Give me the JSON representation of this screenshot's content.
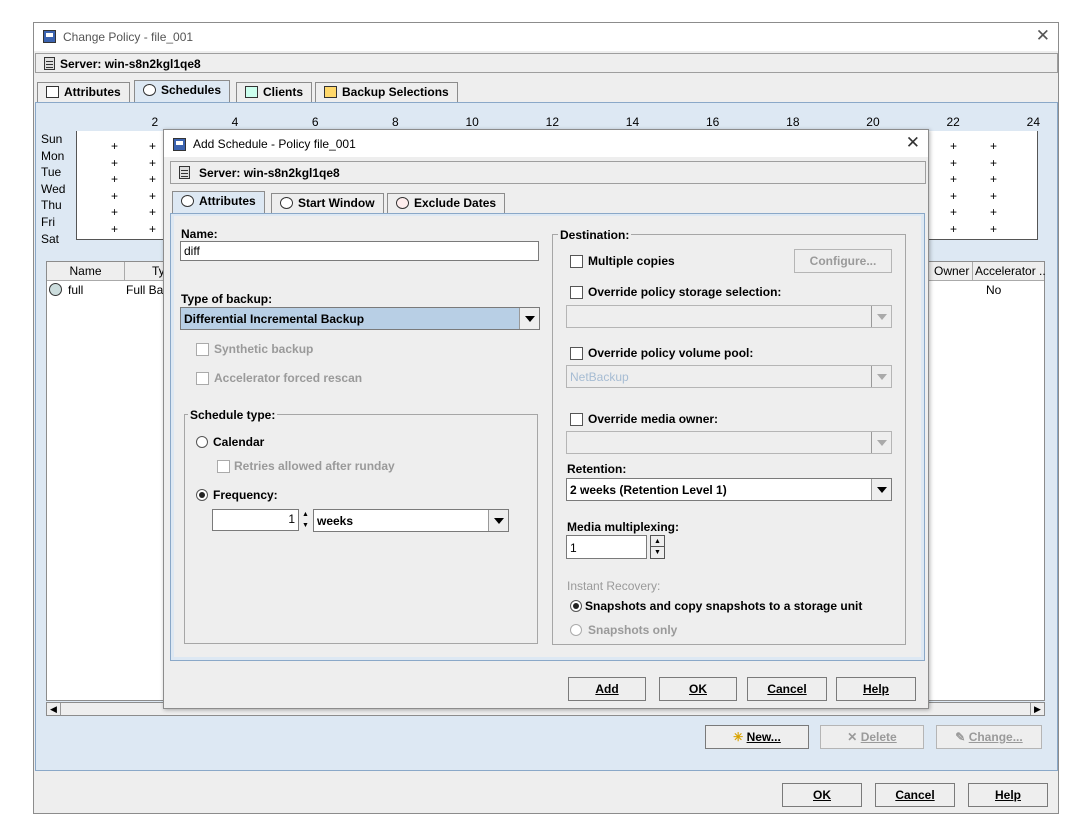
{
  "outer": {
    "title": "Change Policy - file_001",
    "server_label": "Server: win-s8n2kgl1qe8",
    "tabs": [
      "Attributes",
      "Schedules",
      "Clients",
      "Backup Selections"
    ],
    "hours": [
      "2",
      "4",
      "6",
      "8",
      "10",
      "12",
      "14",
      "16",
      "18",
      "20",
      "22",
      "24"
    ],
    "days": [
      "Sun",
      "Mon",
      "Tue",
      "Wed",
      "Thu",
      "Fri",
      "Sat"
    ],
    "columns": [
      "Name",
      "Ty",
      "Owner",
      "Accelerator ..."
    ],
    "row": {
      "name": "full",
      "type": "Full Ba",
      "accelerator": "No"
    },
    "buttons": {
      "new": "New...",
      "delete": "Delete",
      "change": "Change..."
    },
    "footer": {
      "ok": "OK",
      "cancel": "Cancel",
      "help": "Help"
    }
  },
  "dialog": {
    "title": "Add Schedule - Policy file_001",
    "server_label": "Server: win-s8n2kgl1qe8",
    "tabs": [
      "Attributes",
      "Start Window",
      "Exclude Dates"
    ],
    "name_label": "Name:",
    "name_value": "diff",
    "type_label": "Type of backup:",
    "type_value": "Differential Incremental Backup",
    "synthetic": "Synthetic backup",
    "accelerator_rescan": "Accelerator forced rescan",
    "schedule_type_label": "Schedule type:",
    "calendar": "Calendar",
    "retries": "Retries allowed after runday",
    "frequency": "Frequency:",
    "frequency_value": "1",
    "frequency_unit": "weeks",
    "destination_label": "Destination:",
    "multiple_copies": "Multiple copies",
    "configure": "Configure...",
    "override_storage": "Override policy storage selection:",
    "override_volume": "Override policy volume pool:",
    "volume_pool_value": "NetBackup",
    "override_media": "Override media owner:",
    "retention_label": "Retention:",
    "retention_value": "2 weeks (Retention Level 1)",
    "multiplexing_label": "Media multiplexing:",
    "multiplexing_value": "1",
    "instant_recovery_label": "Instant Recovery:",
    "snapshots_copy": "Snapshots and copy snapshots to a storage unit",
    "snapshots_only": "Snapshots only",
    "buttons": {
      "add": "Add",
      "ok": "OK",
      "cancel": "Cancel",
      "help": "Help"
    }
  }
}
